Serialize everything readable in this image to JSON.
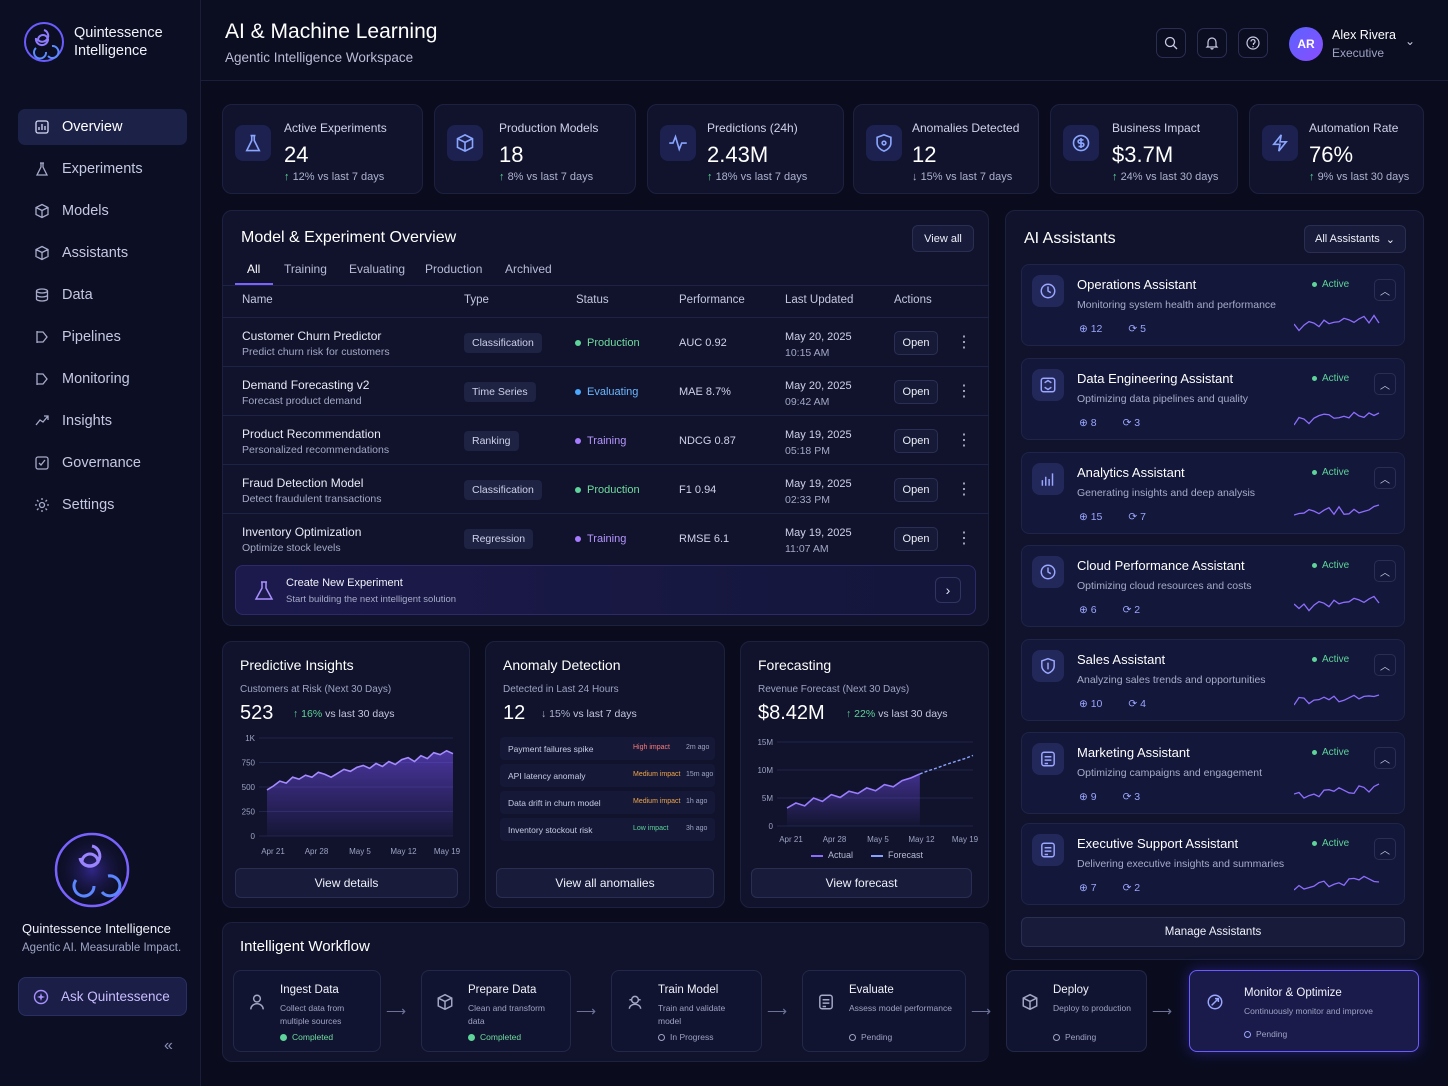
{
  "brand": {
    "name": "Quintessence Intelligence",
    "tagline": "Agentic AI. Measurable Impact."
  },
  "nav": [
    {
      "label": "Overview",
      "icon": "overview-icon",
      "active": true
    },
    {
      "label": "Experiments",
      "icon": "experiments-icon"
    },
    {
      "label": "Models",
      "icon": "models-icon"
    },
    {
      "label": "Assistants",
      "icon": "assistants-icon"
    },
    {
      "label": "Data",
      "icon": "database-icon"
    },
    {
      "label": "Pipelines",
      "icon": "pipelines-icon"
    },
    {
      "label": "Monitoring",
      "icon": "monitoring-icon"
    },
    {
      "label": "Insights",
      "icon": "insights-icon"
    },
    {
      "label": "Governance",
      "icon": "governance-icon"
    },
    {
      "label": "Settings",
      "icon": "gear-icon"
    }
  ],
  "ask_label": "Ask Quintessence",
  "header": {
    "title": "AI & Machine Learning",
    "subtitle": "Agentic Intelligence Workspace"
  },
  "user": {
    "initials": "AR",
    "name": "Alex Rivera",
    "role": "Executive"
  },
  "kpis": [
    {
      "label": "Active Experiments",
      "value": "24",
      "delta": "12%",
      "period": "vs last 7 days",
      "dir": "up",
      "icon": "flask-icon"
    },
    {
      "label": "Production Models",
      "value": "18",
      "delta": "8%",
      "period": "vs last 7 days",
      "dir": "up",
      "icon": "cube-icon"
    },
    {
      "label": "Predictions (24h)",
      "value": "2.43M",
      "delta": "18%",
      "period": "vs last 7 days",
      "dir": "up",
      "icon": "pulse-icon"
    },
    {
      "label": "Anomalies Detected",
      "value": "12",
      "delta": "15%",
      "period": "vs last 7 days",
      "dir": "down",
      "icon": "shield-icon"
    },
    {
      "label": "Business Impact",
      "value": "$3.7M",
      "delta": "24%",
      "period": "vs last 30 days",
      "dir": "up",
      "icon": "dollar-icon"
    },
    {
      "label": "Automation Rate",
      "value": "76%",
      "delta": "9%",
      "period": "vs last 30 days",
      "dir": "up",
      "icon": "bolt-icon"
    }
  ],
  "overview": {
    "title": "Model & Experiment Overview",
    "view_all": "View all",
    "tabs": [
      "All",
      "Training",
      "Evaluating",
      "Production",
      "Archived"
    ],
    "columns": [
      "Name",
      "Type",
      "Status",
      "Performance",
      "Last Updated",
      "Actions"
    ],
    "open_label": "Open",
    "rows": [
      {
        "name": "Customer Churn Predictor",
        "desc": "Predict churn risk for customers",
        "type": "Classification",
        "status": "Production",
        "status_color": "#5ed39a",
        "status_text_color": "#6fdc9f",
        "perf": "AUC 0.92",
        "date": "May 20, 2025",
        "time": "10:15 AM"
      },
      {
        "name": "Demand Forecasting v2",
        "desc": "Forecast product demand",
        "type": "Time Series",
        "status": "Evaluating",
        "status_color": "#4aa8ff",
        "status_text_color": "#6cb6ff",
        "perf": "MAE 8.7%",
        "date": "May 20, 2025",
        "time": "09:42 AM"
      },
      {
        "name": "Product Recommendation",
        "desc": "Personalized recommendations",
        "type": "Ranking",
        "status": "Training",
        "status_color": "#a77bff",
        "status_text_color": "#b495ff",
        "perf": "NDCG 0.87",
        "date": "May 19, 2025",
        "time": "05:18 PM"
      },
      {
        "name": "Fraud Detection Model",
        "desc": "Detect fraudulent transactions",
        "type": "Classification",
        "status": "Production",
        "status_color": "#5ed39a",
        "status_text_color": "#6fdc9f",
        "perf": "F1 0.94",
        "date": "May 19, 2025",
        "time": "02:33 PM"
      },
      {
        "name": "Inventory Optimization",
        "desc": "Optimize stock levels",
        "type": "Regression",
        "status": "Training",
        "status_color": "#a77bff",
        "status_text_color": "#b495ff",
        "perf": "RMSE 6.1",
        "date": "May 19, 2025",
        "time": "11:07 AM"
      }
    ],
    "create": {
      "title": "Create New Experiment",
      "desc": "Start building the next intelligent solution"
    }
  },
  "predictive": {
    "title": "Predictive Insights",
    "subtitle": "Customers at Risk (Next 30 Days)",
    "value": "523",
    "delta": "16%",
    "period": "vs last 30 days",
    "button": "View details",
    "chart_data": {
      "type": "area",
      "x": [
        "Apr 21",
        "Apr 28",
        "May 5",
        "May 12",
        "May 19"
      ],
      "ylim": [
        0,
        1000
      ],
      "yticks": [
        "0",
        "250",
        "500",
        "750",
        "1K"
      ],
      "series": [
        {
          "values": [
            470,
            510,
            560,
            540,
            600,
            580,
            620,
            600,
            650,
            630,
            600,
            640,
            680,
            660,
            700,
            720,
            690,
            740,
            710,
            760,
            730,
            780,
            800,
            760,
            820,
            790,
            850,
            830,
            870,
            840
          ]
        }
      ]
    }
  },
  "anomaly": {
    "title": "Anomaly Detection",
    "subtitle": "Detected in Last 24 Hours",
    "value": "12",
    "delta": "15%",
    "period": "vs last 7 days",
    "button": "View all anomalies",
    "items": [
      {
        "name": "Payment failures spike",
        "impact": "High impact",
        "impact_color": "#ff7a7a",
        "time": "2m ago"
      },
      {
        "name": "API latency anomaly",
        "impact": "Medium impact",
        "impact_color": "#f0a54a",
        "time": "15m ago"
      },
      {
        "name": "Data drift in churn model",
        "impact": "Medium impact",
        "impact_color": "#f0a54a",
        "time": "1h ago"
      },
      {
        "name": "Inventory stockout risk",
        "impact": "Low impact",
        "impact_color": "#5ed39a",
        "time": "3h ago"
      }
    ]
  },
  "forecast": {
    "title": "Forecasting",
    "subtitle": "Revenue Forecast (Next 30 Days)",
    "value": "$8.42M",
    "delta": "22%",
    "period": "vs last 30 days",
    "button": "View forecast",
    "legend_actual": "Actual",
    "legend_forecast": "Forecast",
    "chart_data": {
      "type": "line",
      "x": [
        "Apr 21",
        "Apr 28",
        "May 5",
        "May 12",
        "May 19"
      ],
      "ylim": [
        0,
        15
      ],
      "yticks": [
        "0",
        "5M",
        "10M",
        "15M"
      ],
      "series": [
        {
          "name": "Actual",
          "values": [
            3.2,
            4.1,
            3.6,
            5.0,
            4.4,
            5.6,
            5.1,
            6.2,
            5.8,
            6.8,
            6.3,
            7.4,
            7.0,
            8.1,
            8.6,
            9.3
          ]
        },
        {
          "name": "Forecast",
          "values": [
            9.3,
            9.9,
            10.4,
            11.0,
            11.5,
            12.0,
            12.6
          ]
        }
      ]
    }
  },
  "assistants": {
    "title": "AI Assistants",
    "filter": "All Assistants",
    "manage": "Manage Assistants",
    "active_label": "Active",
    "items": [
      {
        "name": "Operations Assistant",
        "desc": "Monitoring system health and performance",
        "a": "12",
        "b": "5",
        "icon": "operations-icon"
      },
      {
        "name": "Data Engineering Assistant",
        "desc": "Optimizing data pipelines and quality",
        "a": "8",
        "b": "3",
        "icon": "data-engineering-icon"
      },
      {
        "name": "Analytics Assistant",
        "desc": "Generating insights and deep analysis",
        "a": "15",
        "b": "7",
        "icon": "analytics-icon"
      },
      {
        "name": "Cloud Performance Assistant",
        "desc": "Optimizing cloud resources and costs",
        "a": "6",
        "b": "2",
        "icon": "cloud-icon"
      },
      {
        "name": "Sales Assistant",
        "desc": "Analyzing sales trends and opportunities",
        "a": "10",
        "b": "4",
        "icon": "sales-icon"
      },
      {
        "name": "Marketing Assistant",
        "desc": "Optimizing campaigns and engagement",
        "a": "9",
        "b": "3",
        "icon": "marketing-icon"
      },
      {
        "name": "Executive Support Assistant",
        "desc": "Delivering executive insights and summaries",
        "a": "7",
        "b": "2",
        "icon": "executive-icon"
      }
    ]
  },
  "workflow": {
    "title": "Intelligent Workflow",
    "steps": [
      {
        "name": "Ingest Data",
        "desc": "Collect data from multiple sources",
        "status": "Completed",
        "state": "done",
        "icon": "ingest-icon"
      },
      {
        "name": "Prepare Data",
        "desc": "Clean and transform data",
        "status": "Completed",
        "state": "done",
        "icon": "prepare-icon"
      },
      {
        "name": "Train Model",
        "desc": "Train and validate model",
        "status": "In Progress",
        "state": "progress",
        "icon": "train-icon"
      },
      {
        "name": "Evaluate",
        "desc": "Assess model performance",
        "status": "Pending",
        "state": "pending",
        "icon": "evaluate-icon"
      },
      {
        "name": "Deploy",
        "desc": "Deploy to production",
        "status": "Pending",
        "state": "pending",
        "icon": "deploy-icon"
      },
      {
        "name": "Monitor & Optimize",
        "desc": "Continuously monitor and improve",
        "status": "Pending",
        "state": "pending",
        "icon": "monitor-icon"
      }
    ]
  }
}
